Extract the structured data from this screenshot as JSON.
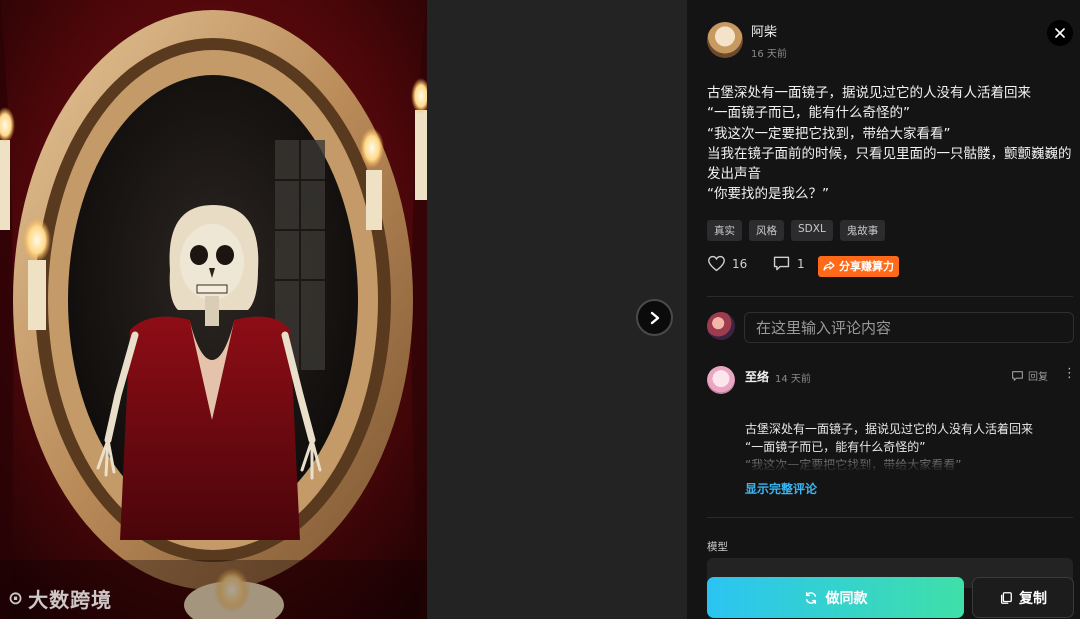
{
  "image": {
    "watermark": "大数跨境"
  },
  "navigation": {
    "next_icon": "chevron-right-icon"
  },
  "post": {
    "author": "阿柴",
    "posted": "16 天前",
    "lines": [
      "古堡深处有一面镜子，据说见过它的人没有人活着回来",
      "“一面镜子而已，能有什么奇怪的”",
      "“我这次一定要把它找到，带给大家看看”",
      "当我在镜子面前的时候，只看见里面的一只骷髅，颤颤巍巍的发出声音",
      "“你要找的是我么？”"
    ],
    "tags": [
      "真实",
      "风格",
      "SDXL",
      "鬼故事"
    ],
    "likes": "16",
    "comments": "1",
    "share_label": "分享赚算力"
  },
  "comment_box": {
    "placeholder": "在这里输入评论内容"
  },
  "comment": {
    "author": "至络",
    "posted": "14 天前",
    "reply_label": "回复",
    "lines": [
      "古堡深处有一面镜子，据说见过它的人没有人活着回来",
      "“一面镜子而已，能有什么奇怪的”",
      "“我这次一定要把它找到，带给大家看看”"
    ],
    "show_full_label": "显示完整评论"
  },
  "model_section": {
    "label": "模型"
  },
  "footer": {
    "make_same_label": "做同款",
    "copy_label": "复制"
  },
  "colors": {
    "accent_gradient_start": "#2bc4f2",
    "accent_gradient_end": "#3fe0a8",
    "share_badge": "#ff6a1a",
    "link": "#3bb5f0"
  }
}
